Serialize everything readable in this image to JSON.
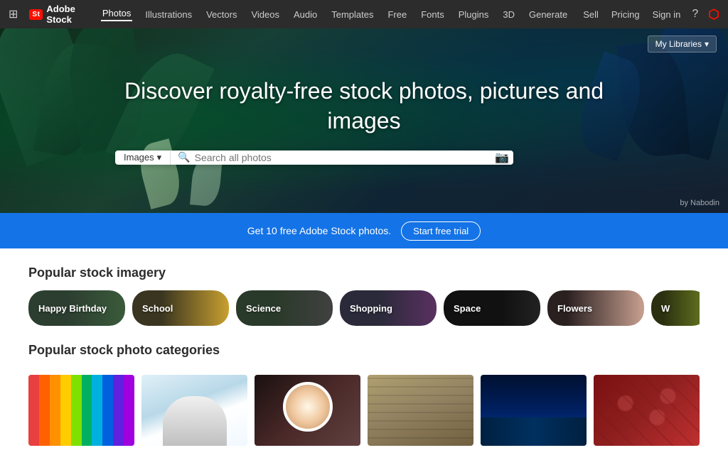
{
  "brand": {
    "badge": "St",
    "name": "Adobe Stock"
  },
  "topnav": {
    "links": [
      {
        "label": "Photos",
        "active": true
      },
      {
        "label": "Illustrations"
      },
      {
        "label": "Vectors"
      },
      {
        "label": "Videos"
      },
      {
        "label": "Audio"
      },
      {
        "label": "Templates"
      },
      {
        "label": "Free"
      },
      {
        "label": "Fonts"
      },
      {
        "label": "Plugins"
      },
      {
        "label": "3D"
      },
      {
        "label": "Generate"
      }
    ],
    "right_links": [
      {
        "label": "Sell"
      },
      {
        "label": "Pricing"
      },
      {
        "label": "Sign in"
      }
    ]
  },
  "hero": {
    "title": "Discover royalty-free stock photos, pictures and images",
    "my_libraries": "My Libraries",
    "by_credit": "by Nabodin"
  },
  "search": {
    "type_label": "Images",
    "placeholder": "Search all photos",
    "chevron": "▾"
  },
  "banner": {
    "text": "Get 10 free Adobe Stock photos.",
    "cta": "Start free trial"
  },
  "popular_imagery": {
    "title": "Popular stock imagery",
    "chips": [
      {
        "label": "Happy Birthday",
        "class": "chip-birthday"
      },
      {
        "label": "School",
        "class": "chip-school"
      },
      {
        "label": "Science",
        "class": "chip-science"
      },
      {
        "label": "Shopping",
        "class": "chip-shopping"
      },
      {
        "label": "Space",
        "class": "chip-space"
      },
      {
        "label": "Flowers",
        "class": "chip-flowers"
      },
      {
        "label": "W",
        "class": "chip-next"
      }
    ]
  },
  "popular_categories": {
    "title": "Popular stock photo categories",
    "thumbs": [
      {
        "index": 0
      },
      {
        "index": 1
      },
      {
        "index": 2
      },
      {
        "index": 3
      },
      {
        "index": 4
      },
      {
        "index": 5
      }
    ]
  }
}
